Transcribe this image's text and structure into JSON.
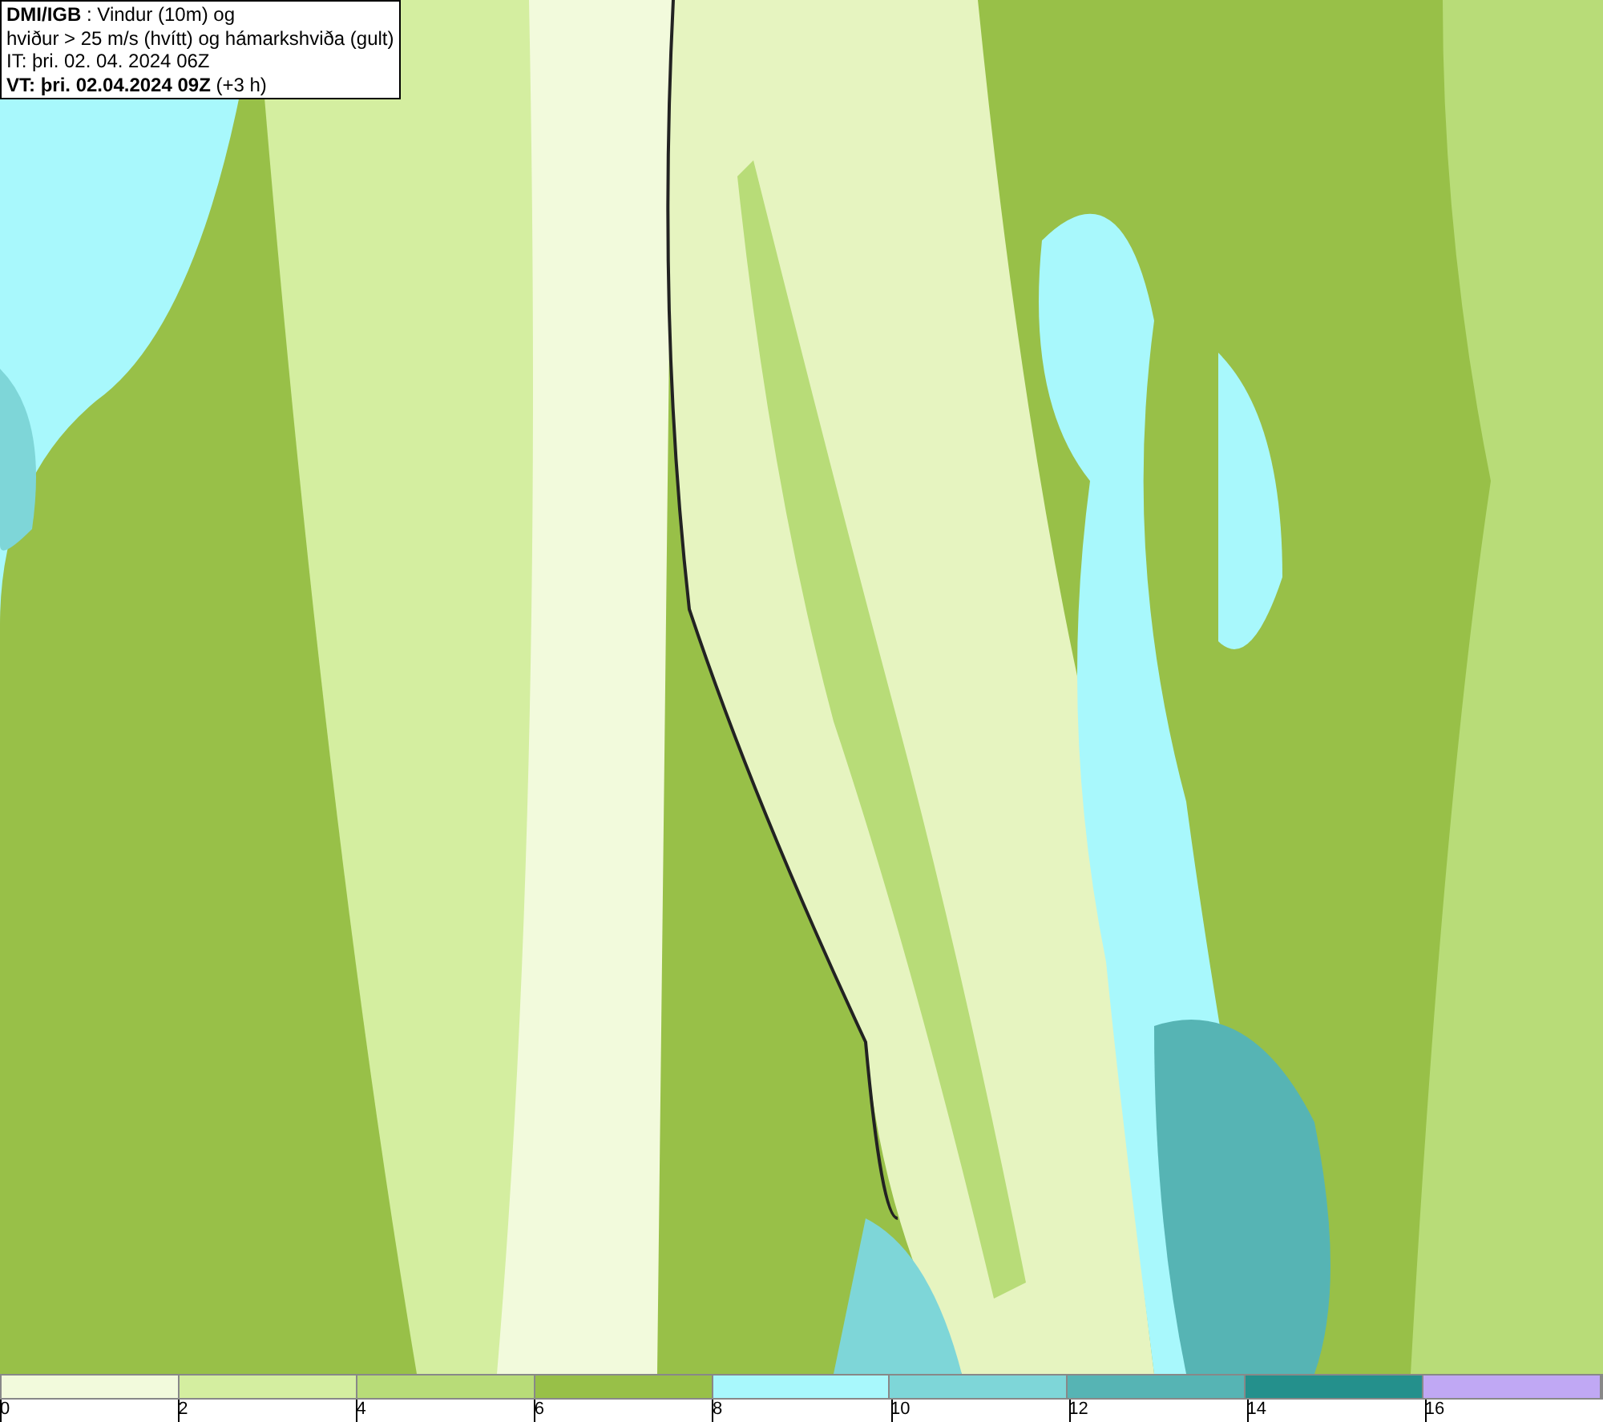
{
  "header": {
    "lines": [
      "**DMI/IGB** : Vindur (10m) og",
      "hviður > 25 m/s (hvítt) og hámarkshviða (gult)",
      "IT: þri. 02. 04. 2024 06Z",
      "**VT: þri. 02.04.2024 09Z** (+3 h)"
    ]
  },
  "legend": [
    {
      "label": "0",
      "color": "#f2fadc"
    },
    {
      "label": "2",
      "color": "#d4eea0"
    },
    {
      "label": "4",
      "color": "#b8dc78"
    },
    {
      "label": "6",
      "color": "#98c048"
    },
    {
      "label": "8",
      "color": "#a8f8fc"
    },
    {
      "label": "10",
      "color": "#7ed6d8"
    },
    {
      "label": "12",
      "color": "#56b4b4"
    },
    {
      "label": "14",
      "color": "#24908c"
    },
    {
      "label": "16",
      "color": "#c0a8f4"
    }
  ]
}
